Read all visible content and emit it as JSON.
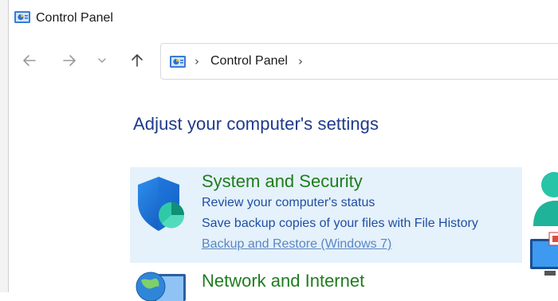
{
  "window": {
    "title": "Control Panel"
  },
  "nav": {
    "back_icon": "arrow-left-icon",
    "forward_icon": "arrow-right-icon",
    "recent_icon": "chevron-down-icon",
    "up_icon": "arrow-up-icon"
  },
  "address": {
    "separator": "›",
    "crumb": "Control Panel",
    "trailing_separator": "›"
  },
  "heading": "Adjust your computer's settings",
  "categories": [
    {
      "title": "System and Security",
      "icon": "shield-icon",
      "links": [
        "Review your computer's status",
        "Save backup copies of your files with File History",
        "Backup and Restore (Windows 7)"
      ]
    },
    {
      "title": "Network and Internet",
      "icon": "globe-icon",
      "links": []
    }
  ],
  "colors": {
    "heading": "#1e3a8a",
    "category_title": "#1e7d1e",
    "link": "#1f4fa3",
    "hover_bg": "#e5f1fb"
  }
}
